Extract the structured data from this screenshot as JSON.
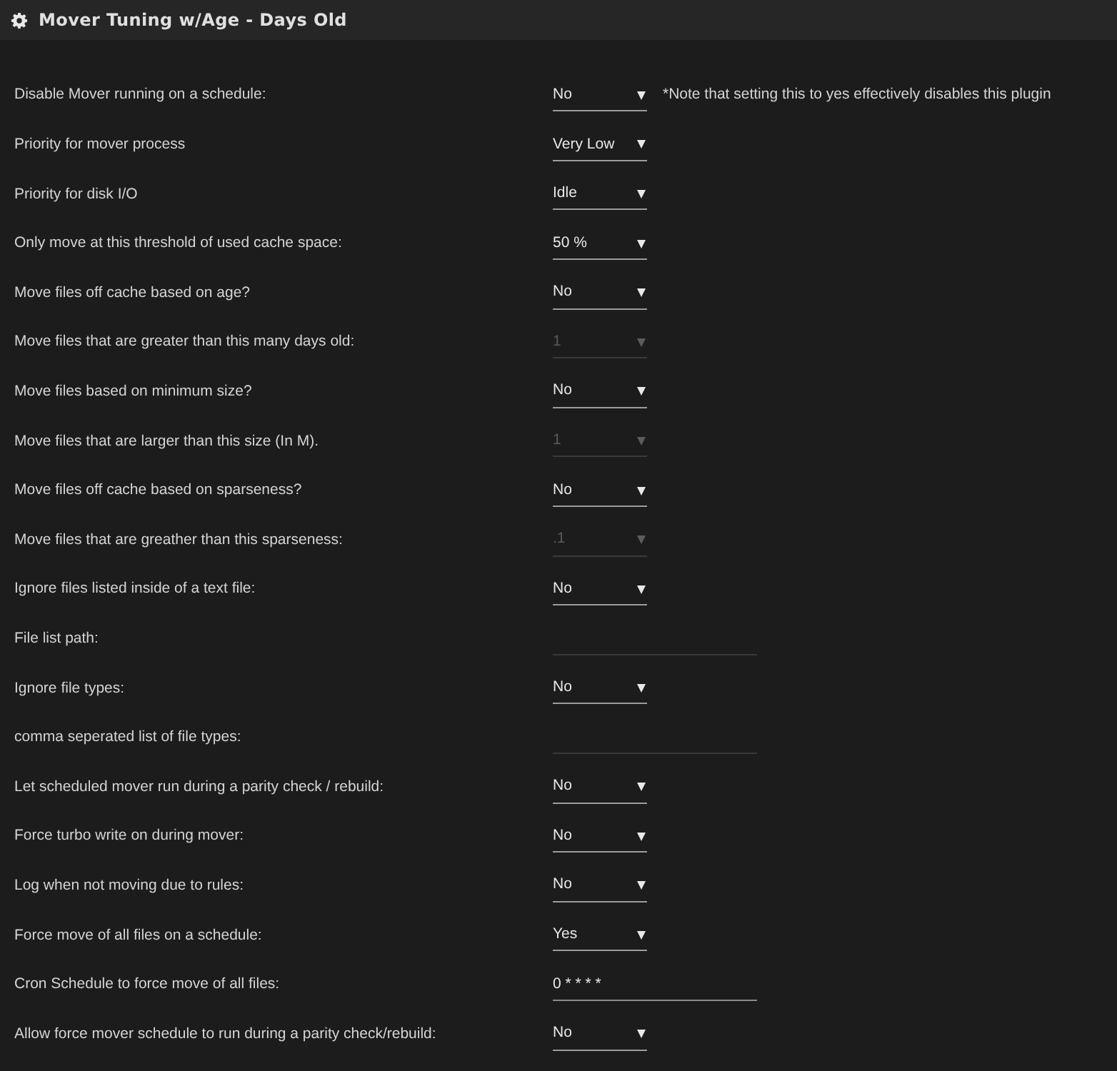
{
  "header": {
    "title": "Mover Tuning w/Age - Days Old"
  },
  "rows": [
    {
      "label": "Disable Mover running on a schedule:",
      "kind": "select",
      "value": "No",
      "disabled": false,
      "note": "*Note that setting this to yes effectively disables this plugin"
    },
    {
      "label": "Priority for mover process",
      "kind": "select",
      "value": "Very Low",
      "disabled": false
    },
    {
      "label": "Priority for disk I/O",
      "kind": "select",
      "value": "Idle",
      "disabled": false
    },
    {
      "label": "Only move at this threshold of used cache space:",
      "kind": "select",
      "value": "50 %",
      "disabled": false
    },
    {
      "label": "Move files off cache based on age?",
      "kind": "select",
      "value": "No",
      "disabled": false
    },
    {
      "label": "Move files that are greater than this many days old:",
      "kind": "select",
      "value": "1",
      "disabled": true
    },
    {
      "label": "Move files based on minimum size?",
      "kind": "select",
      "value": "No",
      "disabled": false
    },
    {
      "label": "Move files that are larger than this size (In M).",
      "kind": "select",
      "value": "1",
      "disabled": true
    },
    {
      "label": "Move files off cache based on sparseness?",
      "kind": "select",
      "value": "No",
      "disabled": false
    },
    {
      "label": "Move files that are greather than this sparseness:",
      "kind": "select",
      "value": ".1",
      "disabled": true
    },
    {
      "label": "Ignore files listed inside of a text file:",
      "kind": "select",
      "value": "No",
      "disabled": false
    },
    {
      "label": "File list path:",
      "kind": "text",
      "disabled": true
    },
    {
      "label": "Ignore file types:",
      "kind": "select",
      "value": "No",
      "disabled": false
    },
    {
      "label": "comma seperated list of file types:",
      "kind": "text",
      "disabled": true
    },
    {
      "label": "Let scheduled mover run during a parity check / rebuild:",
      "kind": "select",
      "value": "No",
      "disabled": false
    },
    {
      "label": "Force turbo write on during mover:",
      "kind": "select",
      "value": "No",
      "disabled": false
    },
    {
      "label": "Log when not moving due to rules:",
      "kind": "select",
      "value": "No",
      "disabled": false
    },
    {
      "label": "Force move of all files on a schedule:",
      "kind": "select",
      "value": "Yes",
      "disabled": false
    },
    {
      "label": "Cron Schedule to force move of all files:",
      "kind": "text",
      "value": "0 * * * *",
      "disabled": false
    },
    {
      "label": "Allow force mover schedule to run during a parity check/rebuild:",
      "kind": "select",
      "value": "No",
      "disabled": false
    }
  ]
}
